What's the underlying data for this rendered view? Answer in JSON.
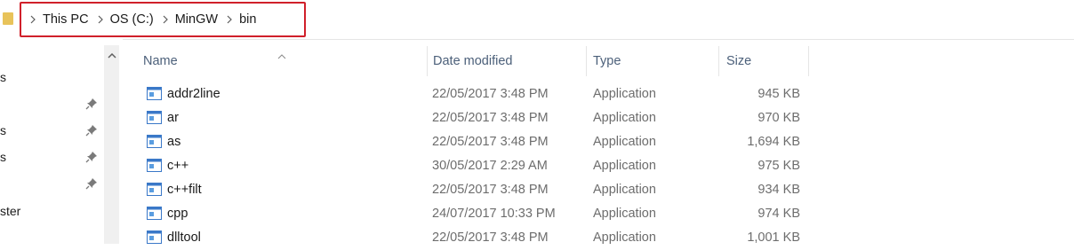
{
  "breadcrumb": [
    "This PC",
    "OS (C:)",
    "MinGW",
    "bin"
  ],
  "nav": {
    "items": [
      "s",
      "s",
      "s",
      "ster"
    ]
  },
  "columns": {
    "name": "Name",
    "date": "Date modified",
    "type": "Type",
    "size": "Size"
  },
  "files": [
    {
      "name": "addr2line",
      "date": "22/05/2017 3:48 PM",
      "type": "Application",
      "size": "945 KB"
    },
    {
      "name": "ar",
      "date": "22/05/2017 3:48 PM",
      "type": "Application",
      "size": "970 KB"
    },
    {
      "name": "as",
      "date": "22/05/2017 3:48 PM",
      "type": "Application",
      "size": "1,694 KB"
    },
    {
      "name": "c++",
      "date": "30/05/2017 2:29 AM",
      "type": "Application",
      "size": "975 KB"
    },
    {
      "name": "c++filt",
      "date": "22/05/2017 3:48 PM",
      "type": "Application",
      "size": "934 KB"
    },
    {
      "name": "cpp",
      "date": "24/07/2017 10:33 PM",
      "type": "Application",
      "size": "974 KB"
    },
    {
      "name": "dlltool",
      "date": "22/05/2017 3:48 PM",
      "type": "Application",
      "size": "1,001 KB"
    }
  ],
  "colors": {
    "highlight": "#d0202a",
    "header_text": "#4c607a",
    "meta_text": "#6d6d6d"
  }
}
